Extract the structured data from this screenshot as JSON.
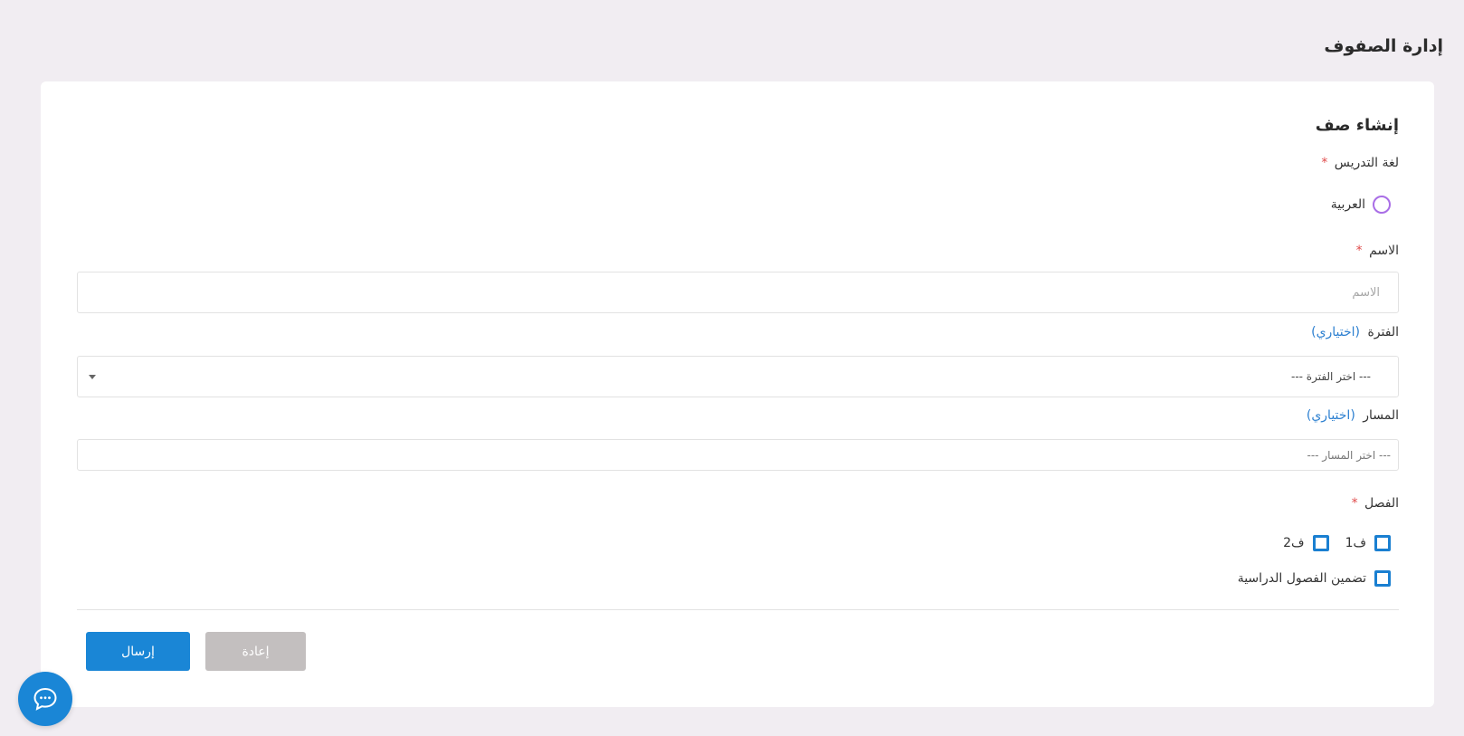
{
  "page": {
    "title": "إدارة الصفوف"
  },
  "form": {
    "title": "إنشاء صف",
    "language": {
      "label": "لغة التدريس",
      "required_mark": "*",
      "options": [
        {
          "label": "العربية",
          "selected": false
        }
      ]
    },
    "name": {
      "label": "الاسم",
      "required_mark": "*",
      "placeholder": "الاسم",
      "value": ""
    },
    "period": {
      "label": "الفترة",
      "optional_text": "(اختياري)",
      "selected": "--- اختر الفترة ---"
    },
    "track": {
      "label": "المسار",
      "optional_text": "(اختياري)",
      "selected": "--- اختر المسار ---"
    },
    "semester": {
      "label": "الفصل",
      "required_mark": "*",
      "options": [
        {
          "label": "ف1",
          "checked": false
        },
        {
          "label": "ف2",
          "checked": false
        }
      ],
      "include_label": "تضمين الفصول الدراسية",
      "include_checked": false
    },
    "buttons": {
      "submit": "إرسال",
      "reset": "إعادة"
    }
  },
  "colors": {
    "primary": "#1a86d6",
    "radio_accent": "#a96ee6",
    "required": "#e04b4b",
    "optional": "#2b7fd0",
    "background": "#f1edf2"
  },
  "icons": {
    "chat": "chat-bubble-icon"
  }
}
